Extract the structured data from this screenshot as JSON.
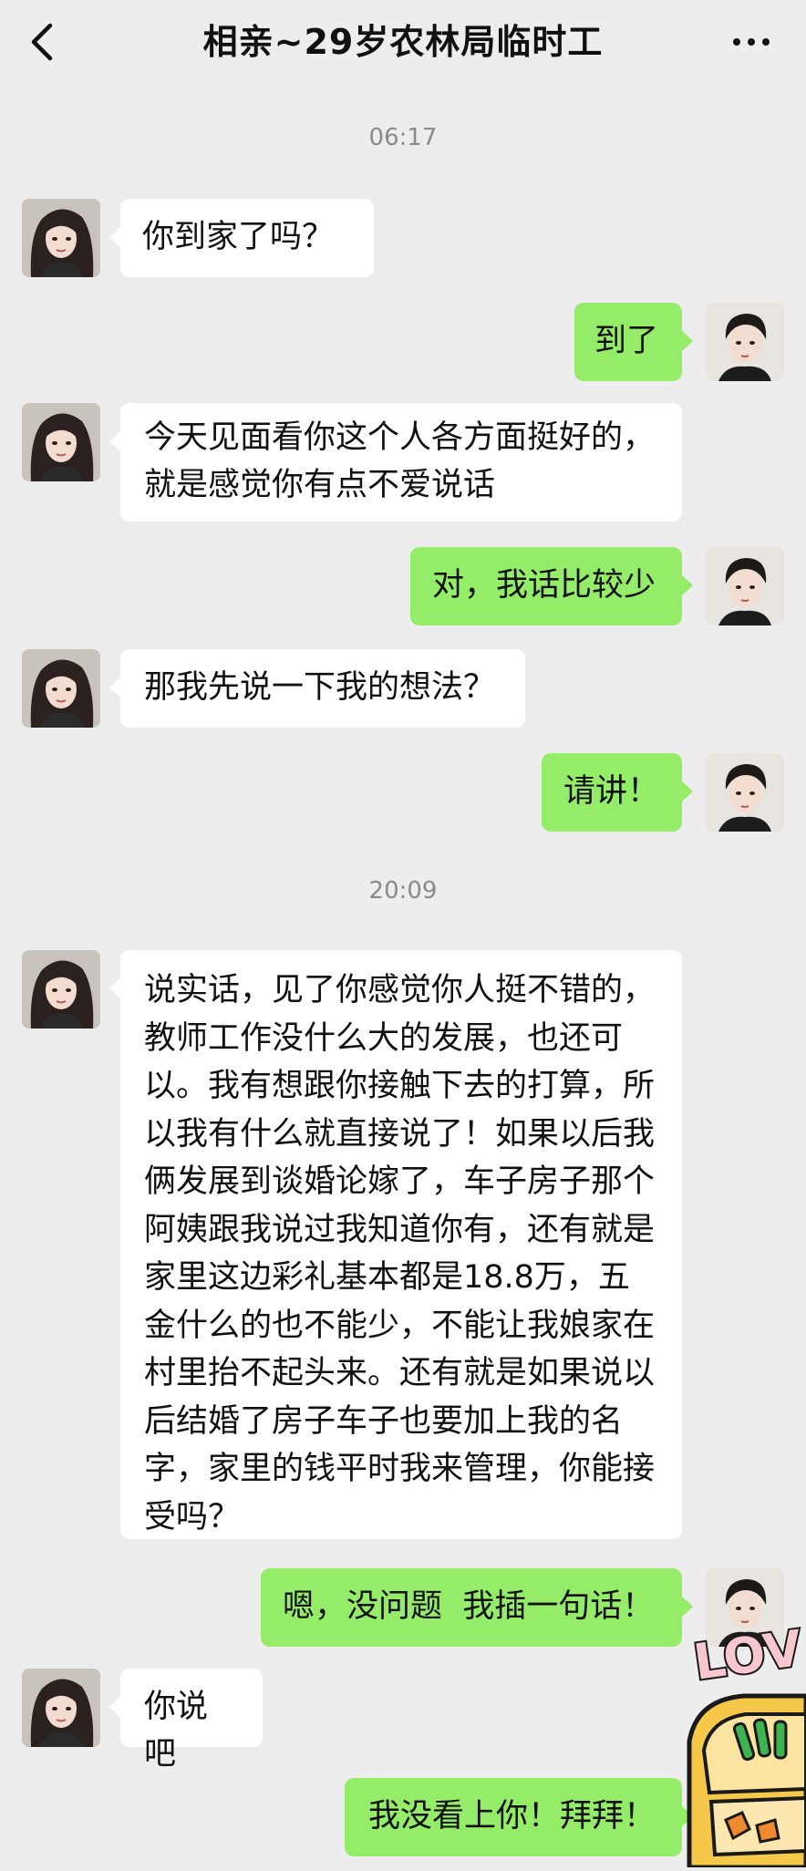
{
  "header": {
    "title": "相亲~29岁农林局临时工",
    "back_icon": "chevron-left-icon",
    "more_icon": "more-dots-icon"
  },
  "timestamps": [
    "06:17",
    "20:09"
  ],
  "messages": [
    {
      "side": "in",
      "text": "你到家了吗？"
    },
    {
      "side": "out",
      "text": "到了"
    },
    {
      "side": "in",
      "text": "今天见面看你这个人各方面挺好的，就是感觉你有点不爱说话"
    },
    {
      "side": "out",
      "text": "对，我话比较少"
    },
    {
      "side": "in",
      "text": "那我先说一下我的想法？"
    },
    {
      "side": "out",
      "text": "请讲！"
    },
    {
      "side": "in",
      "text": "说实话，见了你感觉你人挺不错的，教师工作没什么大的发展，也还可以。我有想跟你接触下去的打算，所以我有什么就直接说了！如果以后我俩发展到谈婚论嫁了，车子房子那个阿姨跟我说过我知道你有，还有就是家里这边彩礼基本都是18.8万，五金什么的也不能少，不能让我娘家在村里抬不起头来。还有就是如果说以后结婚了房子车子也要加上我的名字，家里的钱平时我来管理，你能接受吗？"
    },
    {
      "side": "out",
      "text": "嗯，没问题  我插一句话！"
    },
    {
      "side": "in",
      "text": "你说吧"
    },
    {
      "side": "out",
      "text": "我没看上你！拜拜！"
    }
  ],
  "sticker": {
    "text": "LOV",
    "icon": "love-lunchbox-sticker"
  },
  "colors": {
    "background": "#ededed",
    "incoming_bubble": "#ffffff",
    "outgoing_bubble": "#95ec69",
    "timestamp": "#8a8a8a"
  }
}
